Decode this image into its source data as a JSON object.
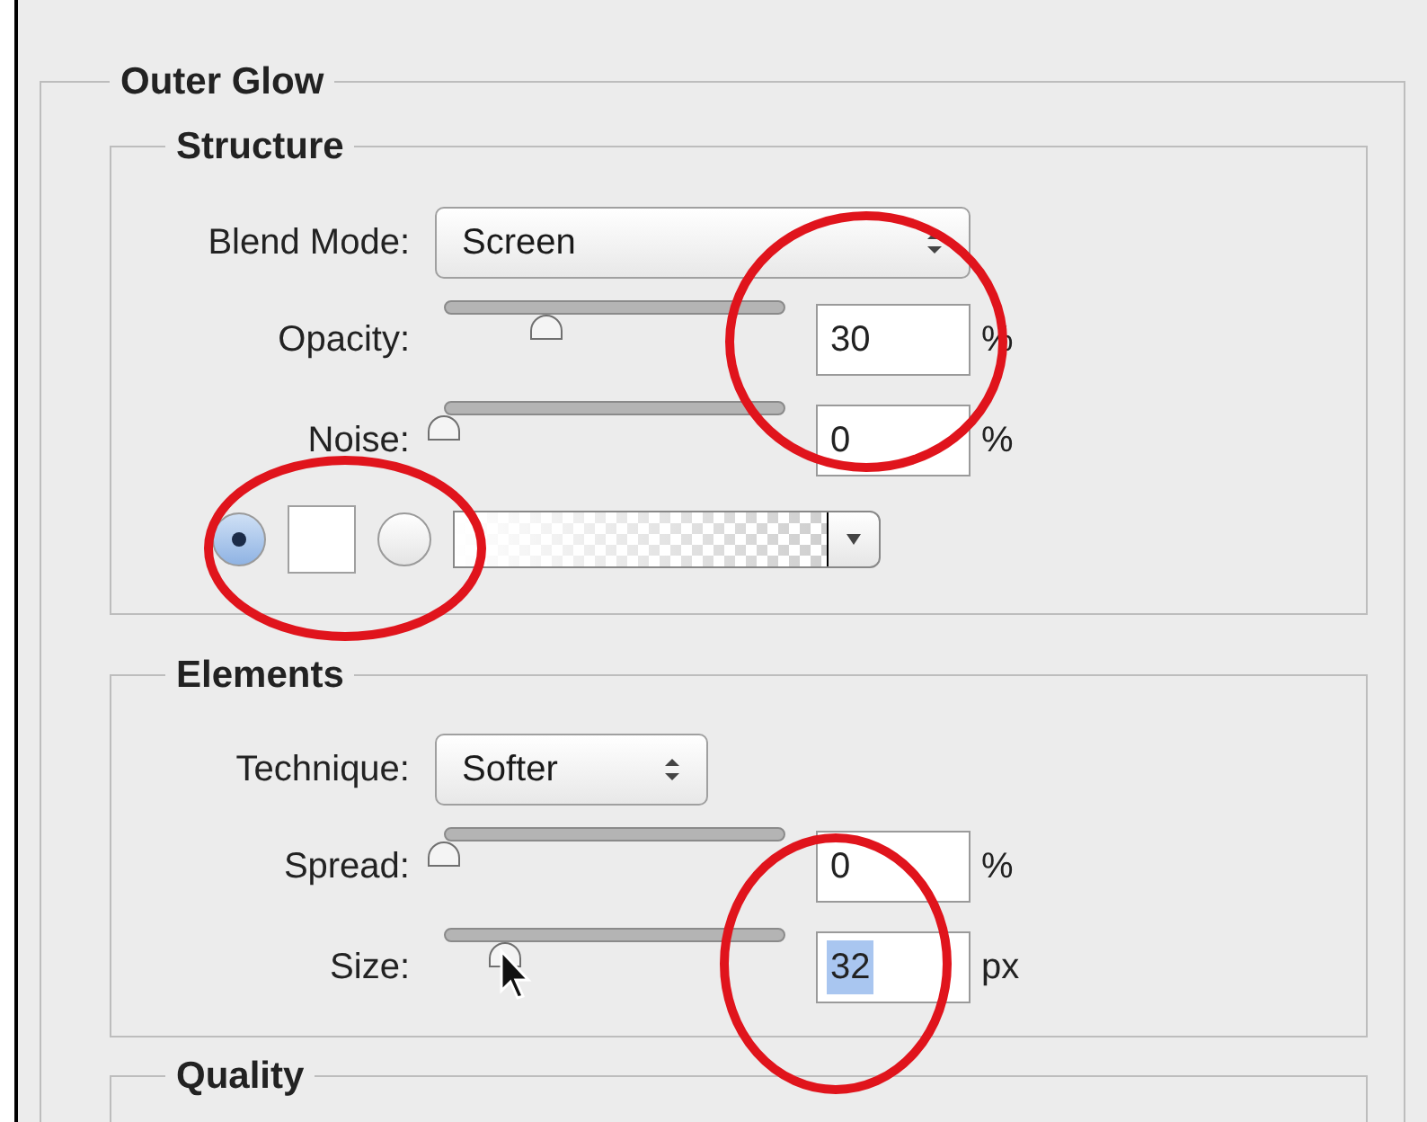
{
  "panel": {
    "title": "Outer Glow"
  },
  "structure": {
    "title": "Structure",
    "blend_mode": {
      "label": "Blend Mode:",
      "value": "Screen"
    },
    "sliders": [
      {
        "label": "Opacity:",
        "level": 0.3,
        "value": "30",
        "unit": "%",
        "highlighted": false
      },
      {
        "label": "Noise:",
        "level": 0,
        "value": "0",
        "unit": "%",
        "highlighted": false
      }
    ],
    "color_options": [
      {
        "kind": "swatch",
        "selected": true
      },
      {
        "kind": "gradient",
        "selected": false
      }
    ]
  },
  "elements": {
    "title": "Elements",
    "technique": {
      "label": "Technique:",
      "value": "Softer"
    },
    "sliders": [
      {
        "label": "Spread:",
        "level": 0,
        "value": "0",
        "unit": "%",
        "highlighted": false
      },
      {
        "label": "Size:",
        "level": 0.18,
        "value": "32",
        "unit": "px",
        "highlighted": true
      }
    ]
  },
  "quality": {
    "title": "Quality"
  }
}
